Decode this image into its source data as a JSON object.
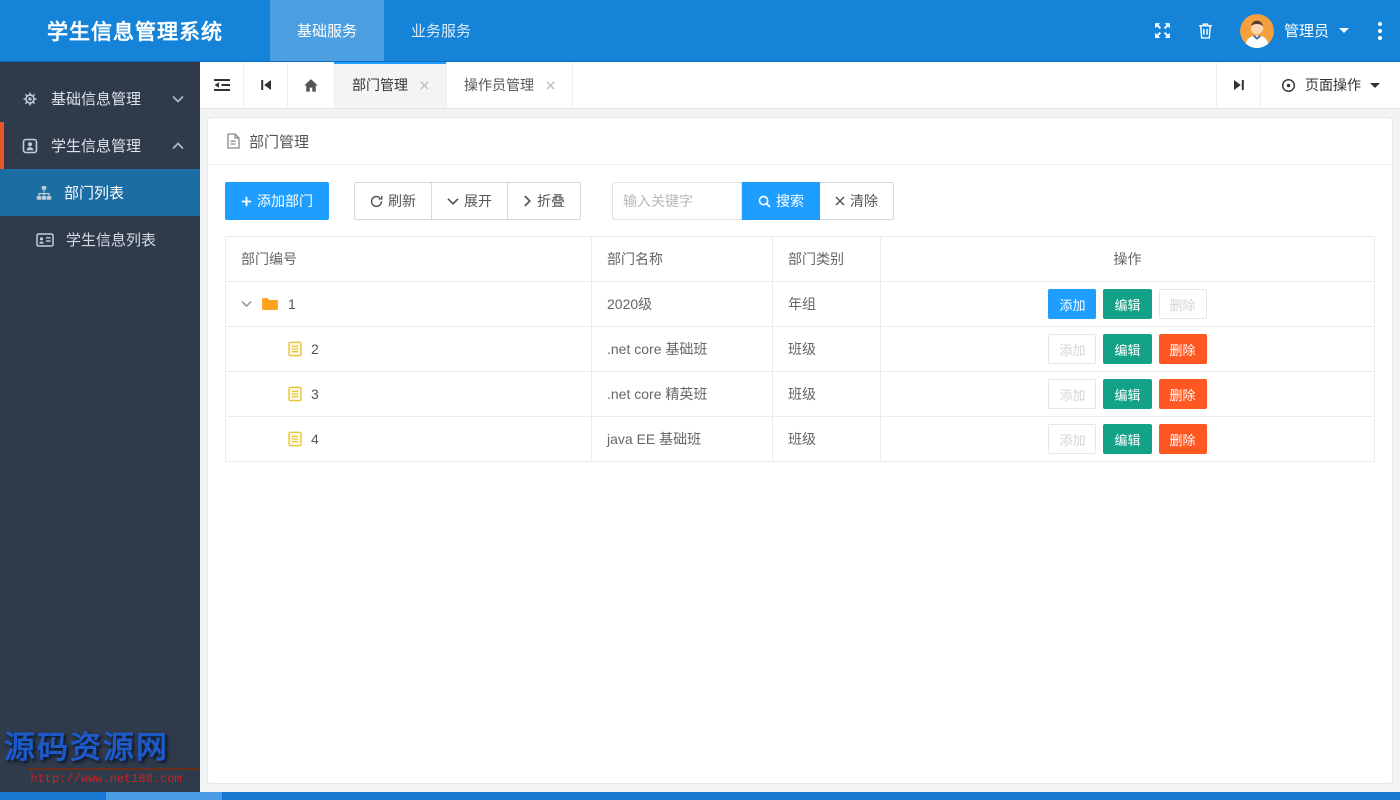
{
  "app": {
    "title": "学生信息管理系统"
  },
  "header": {
    "nav_tabs": [
      {
        "label": "基础服务",
        "active": true
      },
      {
        "label": "业务服务",
        "active": false
      }
    ],
    "user_name": "管理员",
    "icons": [
      "fullscreen-icon",
      "trash-icon",
      "avatar",
      "more-dots-icon"
    ]
  },
  "sidebar": {
    "items": [
      {
        "label": "基础信息管理",
        "icon": "gear-icon",
        "expanded": false
      },
      {
        "label": "学生信息管理",
        "icon": "student-badge-icon",
        "expanded": true
      }
    ],
    "subitems": [
      {
        "label": "部门列表",
        "icon": "sitemap-icon",
        "active": true
      },
      {
        "label": "学生信息列表",
        "icon": "id-card-icon",
        "active": false
      }
    ],
    "watermark": {
      "title": "源码资源网",
      "url": "http://www.net188.com"
    }
  },
  "tabbar": {
    "tabs": [
      {
        "label": "部门管理",
        "active": true
      },
      {
        "label": "操作员管理",
        "active": false
      }
    ],
    "page_actions": "页面操作"
  },
  "page": {
    "title": "部门管理",
    "toolbar": {
      "add": "添加部门",
      "refresh": "刷新",
      "expand": "展开",
      "collapse": "折叠",
      "search_placeholder": "输入关键字",
      "search": "搜索",
      "clear": "清除"
    },
    "table": {
      "columns": [
        "部门编号",
        "部门名称",
        "部门类别",
        "操作"
      ],
      "action_labels": {
        "add": "添加",
        "edit": "编辑",
        "delete": "删除"
      },
      "rows": [
        {
          "id": "1",
          "name": "2020级",
          "category": "年组",
          "node": "folder-open",
          "add_enabled": true,
          "edit_enabled": true,
          "delete_enabled": false
        },
        {
          "id": "2",
          "name": ".net core 基础班",
          "category": "班级",
          "node": "leaf",
          "add_enabled": false,
          "edit_enabled": true,
          "delete_enabled": true
        },
        {
          "id": "3",
          "name": ".net core 精英班",
          "category": "班级",
          "node": "leaf",
          "add_enabled": false,
          "edit_enabled": true,
          "delete_enabled": true
        },
        {
          "id": "4",
          "name": "java EE 基础班",
          "category": "班级",
          "node": "leaf",
          "add_enabled": false,
          "edit_enabled": true,
          "delete_enabled": true
        }
      ]
    }
  },
  "colors": {
    "header_blue": "#1483d8",
    "primary_blue": "#1E9FFF",
    "edit_green": "#13a287",
    "delete_orange": "#ff5722",
    "sidebar_dark": "#2f3a4b",
    "sidebar_active_blue": "#1c6da3",
    "accent_orange": "#e8562d",
    "folder_yellow": "#ffa21d"
  }
}
